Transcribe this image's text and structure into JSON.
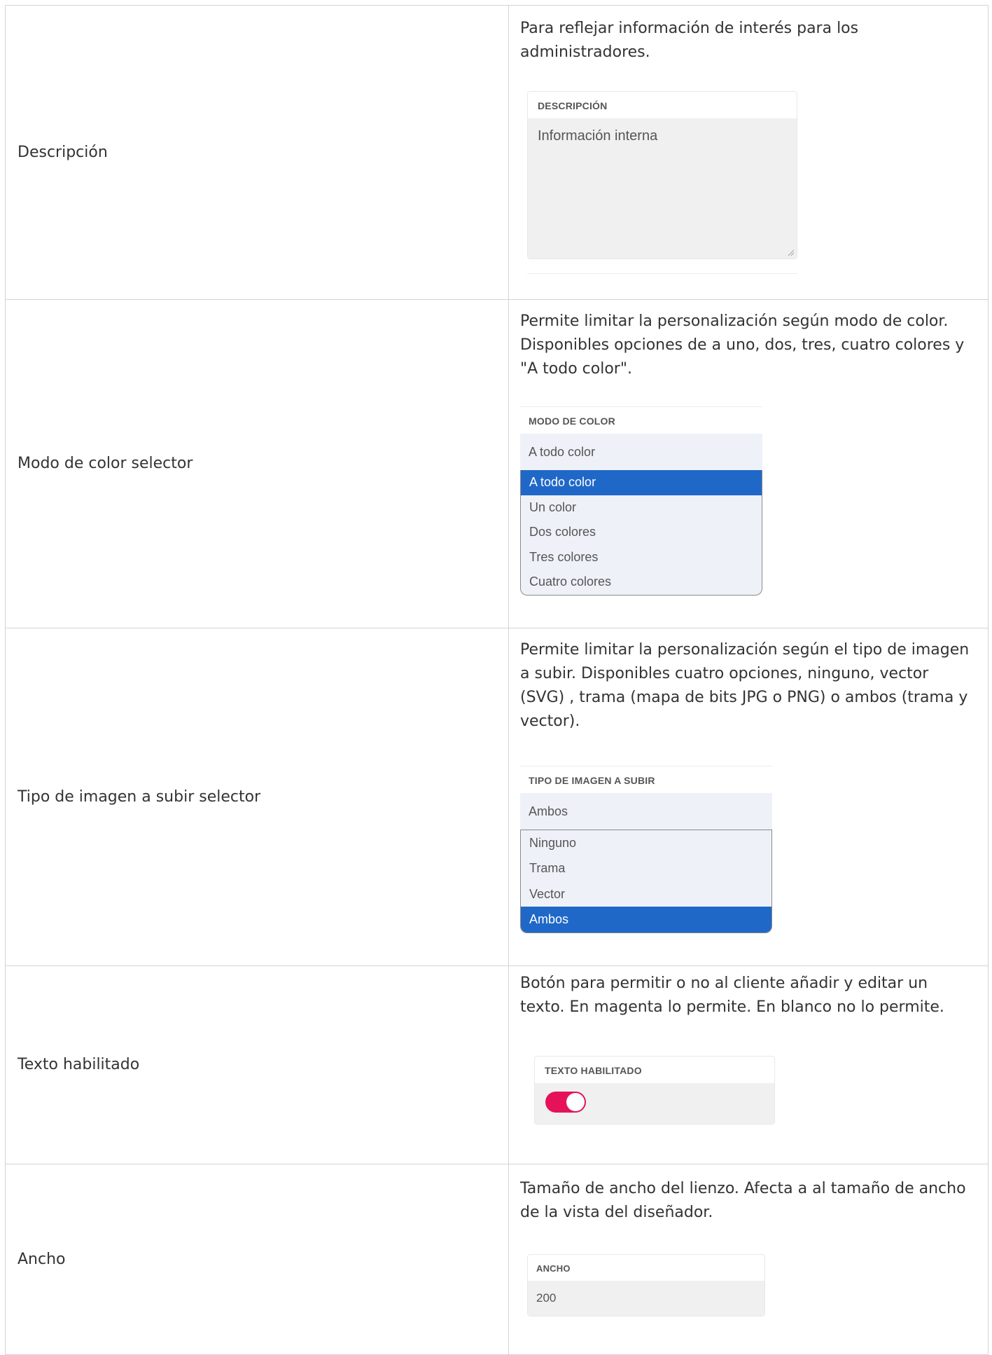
{
  "rows": [
    {
      "name": "Descripción",
      "description": "Para reflejar información de interés para los administradores.",
      "widget": {
        "label": "DESCRIPCIÓN",
        "value": "Información interna"
      }
    },
    {
      "name": "Modo de color selector",
      "description": "Permite limitar la personalización según modo de color. Disponibles opciones de a uno, dos, tres, cuatro colores y \"A todo color\".",
      "widget": {
        "label": "MODO DE COLOR",
        "current": "A todo color",
        "options": [
          "A todo color",
          "Un color",
          "Dos colores",
          "Tres colores",
          "Cuatro colores"
        ]
      }
    },
    {
      "name": "Tipo de imagen a subir selector",
      "description": "Permite limitar la personalización según el tipo de imagen a subir. Disponibles cuatro opciones, ninguno, vector (SVG) , trama (mapa de bits JPG o PNG) o ambos (trama y vector).",
      "widget": {
        "label": "TIPO DE IMAGEN A SUBIR",
        "current": "Ambos",
        "options": [
          "Ninguno",
          "Trama",
          "Vector",
          "Ambos"
        ]
      }
    },
    {
      "name": "Texto habilitado",
      "description": "Botón para permitir o no al cliente añadir y editar un texto. En magenta lo permite. En blanco no lo permite.",
      "widget": {
        "label": "TEXTO HABILITADO",
        "enabled": true
      }
    },
    {
      "name": "Ancho",
      "description": "Tamaño de ancho del lienzo. Afecta a al tamaño de ancho de la vista del diseñador.",
      "widget": {
        "label": "ANCHO",
        "value": "200"
      }
    }
  ],
  "colors": {
    "selected": "#1f68c8",
    "toggle_on": "#e5125a",
    "border": "#d4d4d4"
  }
}
